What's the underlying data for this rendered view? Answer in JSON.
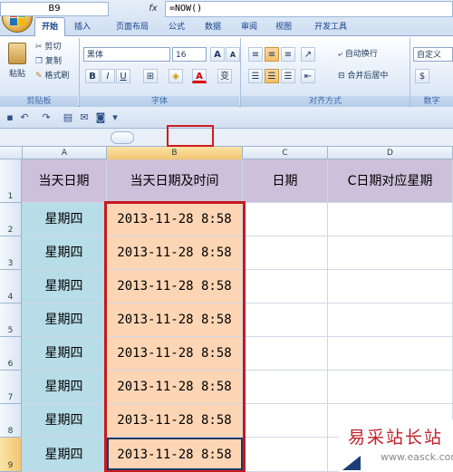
{
  "ribbon": {
    "tabs": [
      "开始",
      "插入",
      "页面布局",
      "公式",
      "数据",
      "审阅",
      "视图",
      "开发工具"
    ],
    "active_tab": "开始",
    "clipboard": {
      "paste": "粘贴",
      "cut": "剪切",
      "copy": "复制",
      "format_painter": "格式刷",
      "group_label": "剪贴板"
    },
    "font": {
      "name": "黑体",
      "size": "16",
      "bold": "B",
      "italic": "I",
      "underline": "U",
      "grow": "A",
      "shrink": "A",
      "group_label": "字体",
      "font_color_glyph": "A",
      "phonetic": "变"
    },
    "alignment": {
      "wrap_text": "自动换行",
      "merge_center": "合并后居中",
      "group_label": "对齐方式"
    },
    "number": {
      "format": "自定义",
      "group_label": "数字"
    }
  },
  "formula_bar": {
    "name_box": "B9",
    "fx": "fx",
    "formula": "=NOW()"
  },
  "grid": {
    "columns": [
      "A",
      "B",
      "C",
      "D"
    ],
    "rows": [
      "1",
      "2",
      "3",
      "4",
      "5",
      "6",
      "7",
      "8",
      "9"
    ],
    "header_row": [
      "当天日期",
      "当天日期及时间",
      "日期",
      "C日期对应星期"
    ],
    "col_a": [
      "星期四",
      "星期四",
      "星期四",
      "星期四",
      "星期四",
      "星期四",
      "星期四",
      "星期四"
    ],
    "col_b": [
      "2013-11-28  8:58",
      "2013-11-28  8:58",
      "2013-11-28  8:58",
      "2013-11-28  8:58",
      "2013-11-28  8:58",
      "2013-11-28  8:58",
      "2013-11-28  8:58",
      "2013-11-28  8:58"
    ],
    "active_cell": "B9"
  },
  "watermark": {
    "text": "易采站长站",
    "url": "www.easck.com"
  },
  "colors": {
    "header_purple": "#ccc0da",
    "col_a_blue": "#b7dde8",
    "col_b_orange": "#fcd5b4",
    "highlight_red": "#c8191e"
  }
}
